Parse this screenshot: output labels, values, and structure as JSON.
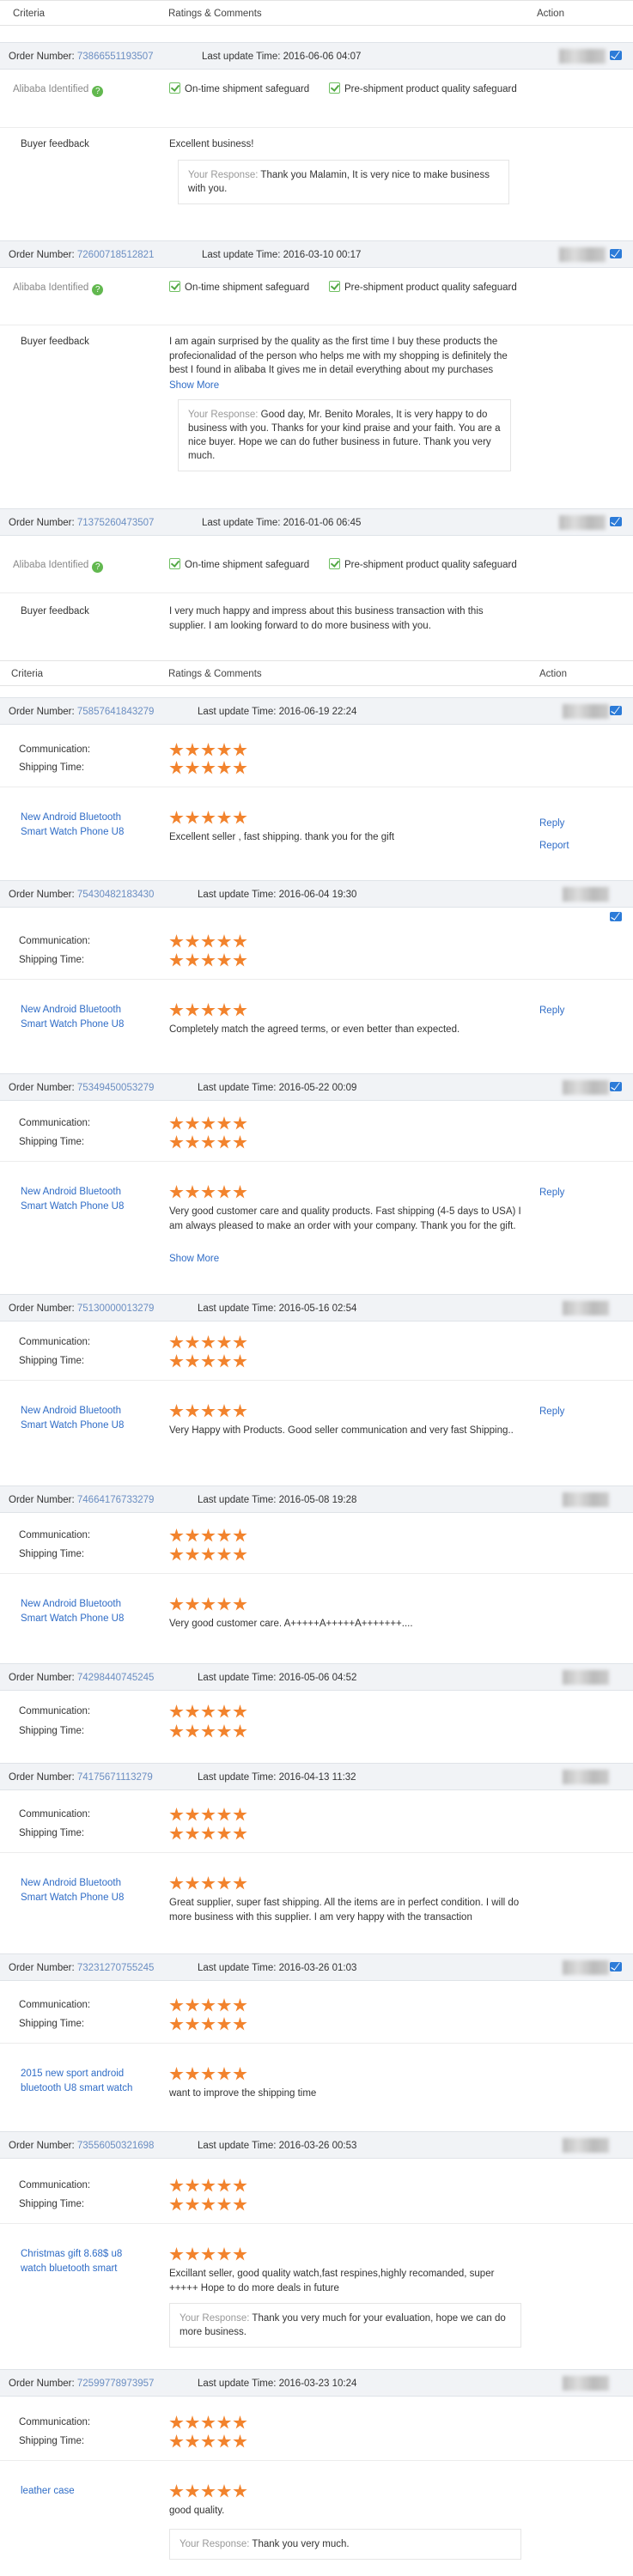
{
  "headers": {
    "criteria": "Criteria",
    "ratings": "Ratings & Comments",
    "action": "Action"
  },
  "labels": {
    "order_number": "Order Number:",
    "last_update": "Last update Time:",
    "alibaba_identified": "Alibaba Identified",
    "on_time": "On-time shipment safeguard",
    "pre_shipment": "Pre-shipment product quality safeguard",
    "buyer_feedback": "Buyer feedback",
    "your_response": "Your Response:",
    "show_more": "Show More",
    "communication": "Communication:",
    "shipping_time": "Shipping Time:",
    "reply": "Reply",
    "report": "Report"
  },
  "buyer_orders": [
    {
      "order": "73866551193507",
      "time": "2016-06-06 04:07",
      "feedback": "Excellent business!",
      "response": "Thank you Malamin, It is very nice to make business with you."
    },
    {
      "order": "72600718512821",
      "time": "2016-03-10 00:17",
      "feedback": "I am again surprised by the quality as the first time I buy these products the profecionalidad of the person who helps me with my shopping is definitely the best I found in alibaba It gives me in detail everything about my purchases",
      "response": "Good day, Mr. Benito Morales, It is very happy to do business with you. Thanks for your kind praise and your faith. You are a nice buyer. Hope we can do futher business in future. Thank you very much."
    },
    {
      "order": "71375260473507",
      "time": "2016-01-06 06:45",
      "feedback": "I very much happy and impress about this business transaction with this supplier. I am looking forward to do more business with you."
    }
  ],
  "supplier_orders": [
    {
      "order": "75857641843279",
      "time": "2016-06-19 22:24",
      "product": "New Android Bluetooth Smart Watch Phone U8",
      "comment": "Excellent seller , fast shipping. thank you for the gift"
    },
    {
      "order": "75430482183430",
      "time": "2016-06-04 19:30",
      "product": "New Android Bluetooth Smart Watch Phone U8",
      "comment": "Completely match the agreed terms, or even better than expected."
    },
    {
      "order": "75349450053279",
      "time": "2016-05-22 00:09",
      "product": "New Android Bluetooth Smart Watch Phone U8",
      "comment": "Very good customer care and quality products. Fast shipping (4-5 days to USA) I am always pleased to make an order with your company. Thank you for the gift."
    },
    {
      "order": "75130000013279",
      "time": "2016-05-16 02:54",
      "product": "New Android Bluetooth Smart Watch Phone U8",
      "comment": "Very Happy with Products. Good seller communication and very fast Shipping.."
    },
    {
      "order": "74664176733279",
      "time": "2016-05-08 19:28",
      "product": "New Android Bluetooth Smart Watch Phone U8",
      "comment": "Very good customer care. A+++++A+++++A+++++++...."
    },
    {
      "order": "74298440745245",
      "time": "2016-05-06 04:52"
    },
    {
      "order": "74175671113279",
      "time": "2016-04-13 11:32",
      "product": "New Android Bluetooth Smart Watch Phone U8",
      "comment": "Great supplier, super fast shipping. All the items are in perfect condition. I will do more business with this supplier. I am very happy with the transaction"
    },
    {
      "order": "73231270755245",
      "time": "2016-03-26 01:03",
      "product": "2015 new sport android bluetooth U8 smart watch",
      "comment": "want to improve the shipping time"
    },
    {
      "order": "73556050321698",
      "time": "2016-03-26 00:53",
      "product": "Christmas gift 8.68$ u8 watch bluetooth smart",
      "comment": "Excillant seller, good quality watch,fast respines,highly recomanded, super +++++ Hope to do more deals in future",
      "response": "Thank you very much for your evaluation, hope we can do more business."
    },
    {
      "order": "72599778973957",
      "time": "2016-03-23 10:24",
      "product": "leather case",
      "comment": "good quality.",
      "response": "Thank you very much."
    }
  ],
  "ratings": {
    "communication_stars": 5,
    "shipping_stars": 5,
    "product_stars": 5
  }
}
